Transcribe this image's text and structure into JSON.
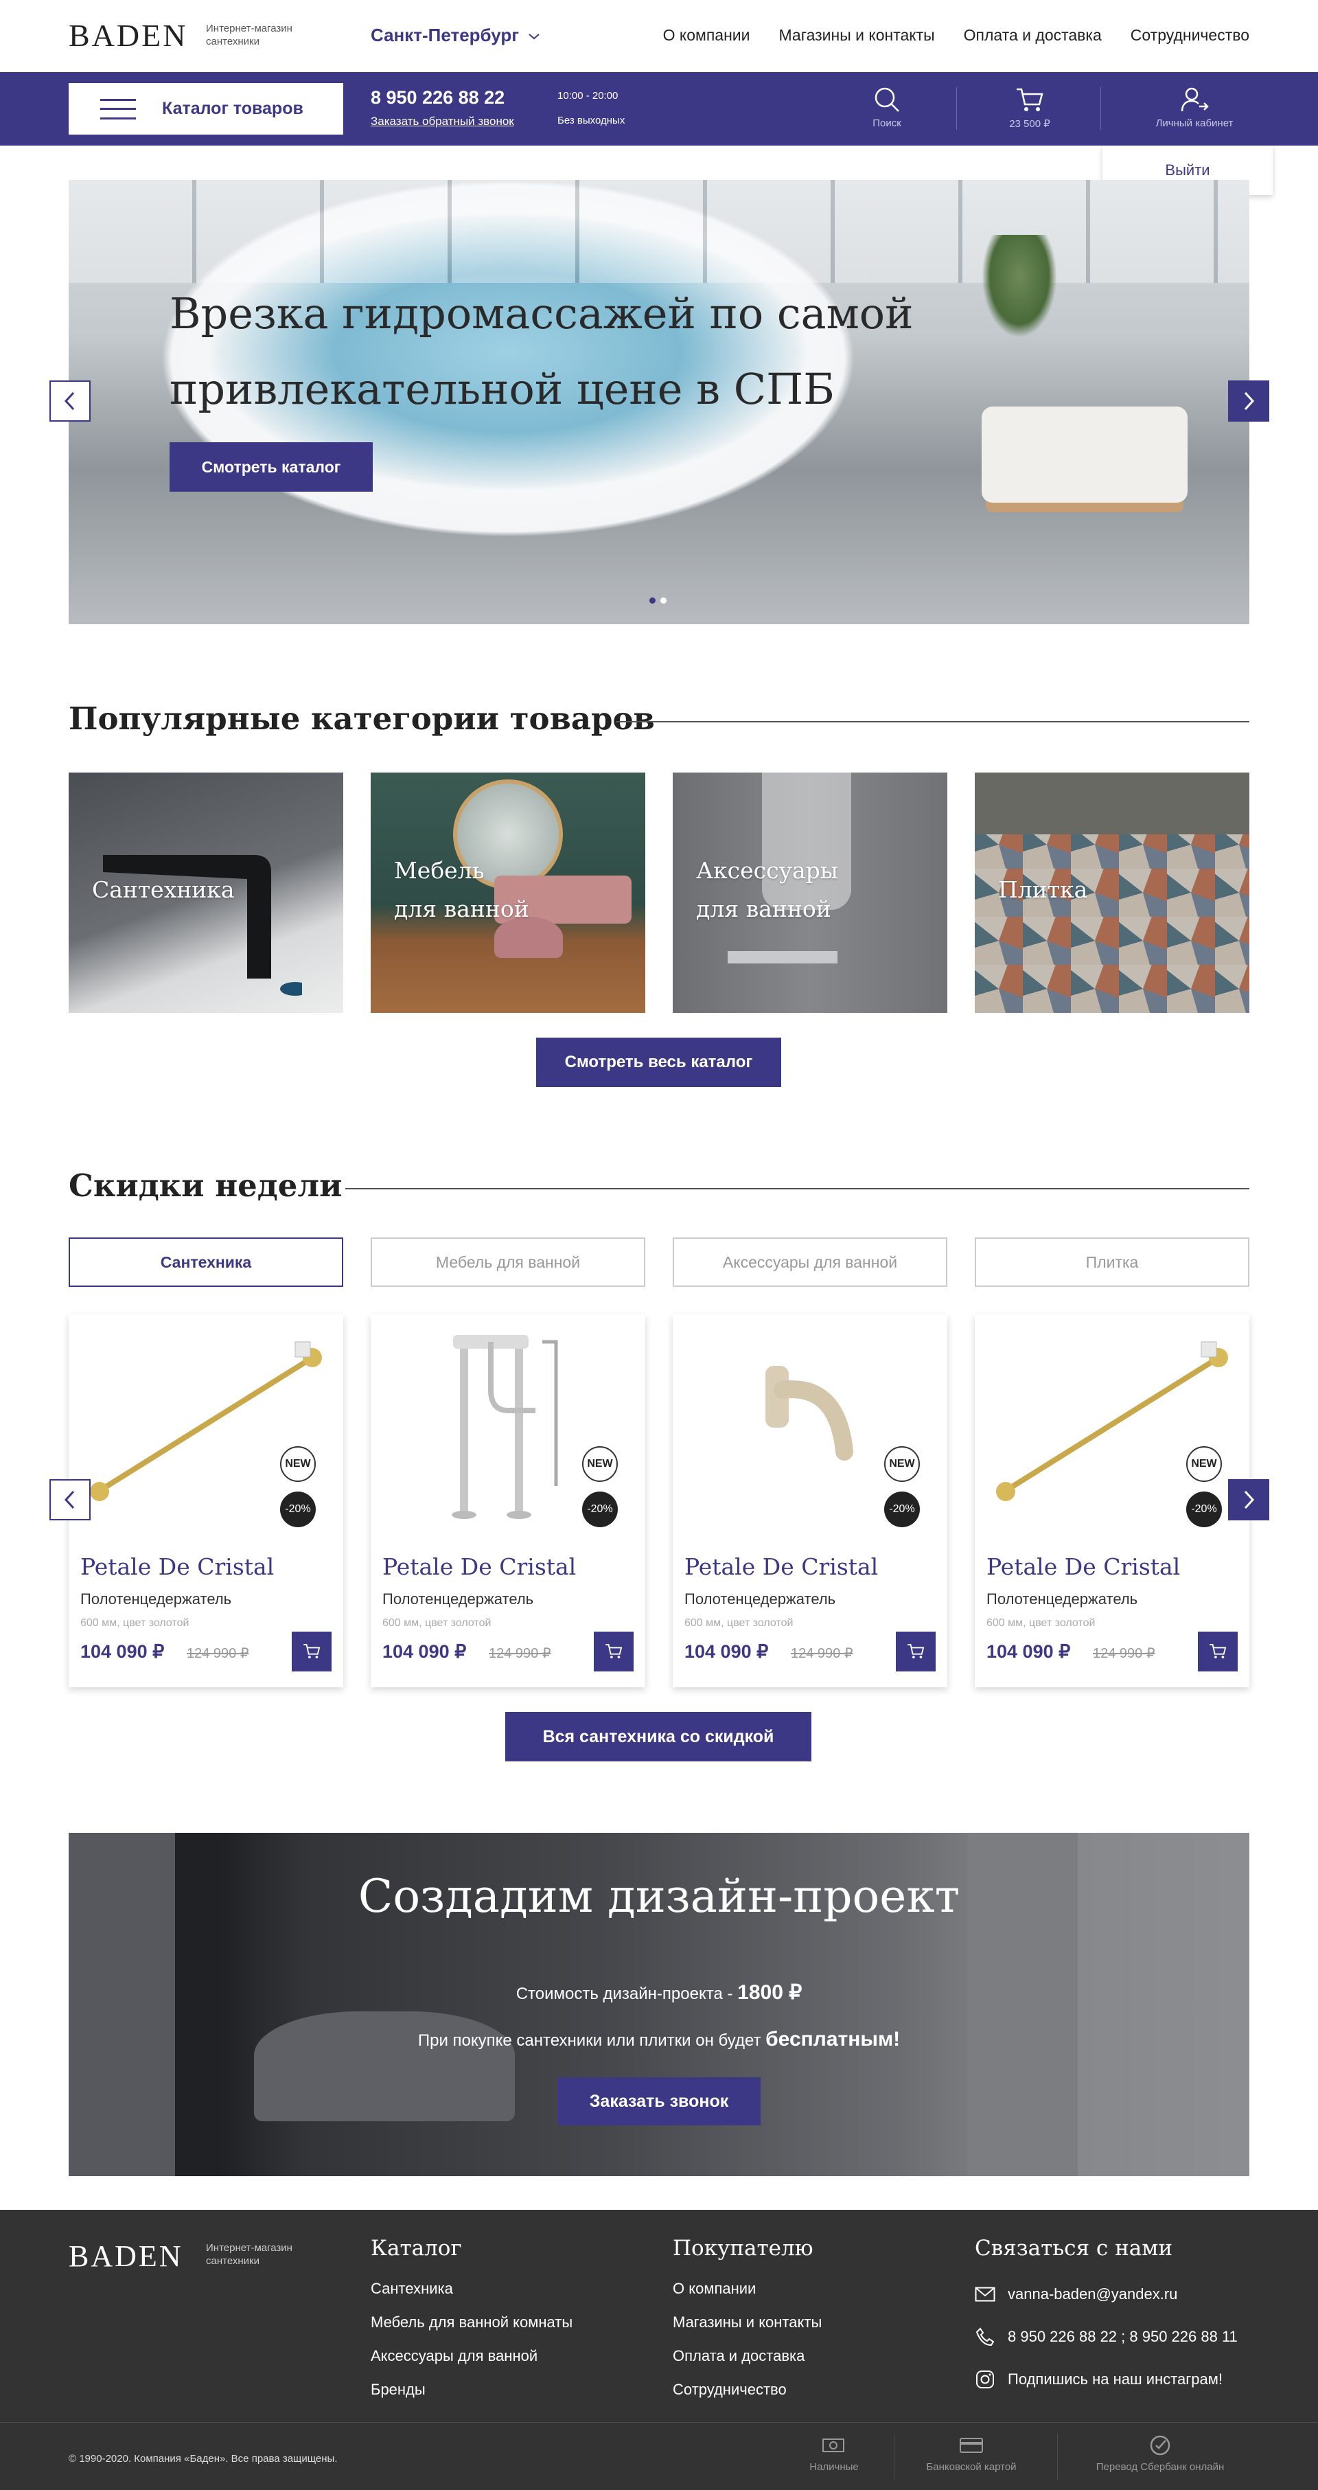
{
  "brand": {
    "logo": "BADEN",
    "tagline": "Интернет-магазин сантехники"
  },
  "header": {
    "city": "Санкт-Петербург",
    "nav": [
      "О компании",
      "Магазины и контакты",
      "Оплата и доставка",
      "Сотрудничество"
    ]
  },
  "bar": {
    "catalog_label": "Каталог товаров",
    "phone": "8 950 226 88 22",
    "callback": "Заказать обратный звонок",
    "hours": "10:00 - 20:00",
    "days": "Без выходных",
    "search": "Поиск",
    "cart_total": "23 500 ₽",
    "account": "Личный кабинет",
    "logout": "Выйти"
  },
  "hero": {
    "title": "Врезка гидромассажей по самой привлекательной цене в СПБ",
    "button": "Смотреть каталог",
    "slides": 2,
    "active_slide": 1
  },
  "categories": {
    "title": "Популярные категории товаров",
    "items": [
      {
        "line1": "Сантехника",
        "line2": ""
      },
      {
        "line1": "Мебель",
        "line2": "для ванной"
      },
      {
        "line1": "Аксессуары",
        "line2": "для ванной"
      },
      {
        "line1": "Плитка",
        "line2": ""
      }
    ],
    "button": "Смотреть весь каталог"
  },
  "discounts": {
    "title": "Скидки недели",
    "tabs": [
      "Сантехника",
      "Мебель для ванной",
      "Аксессуары для ванной",
      "Плитка"
    ],
    "active_tab": 0,
    "products": [
      {
        "name": "Petale De Cristal",
        "type": "Полотенцедержатель",
        "spec": "600 мм, цвет золотой",
        "price": "104 090 ₽",
        "old_price": "124 990 ₽",
        "badge_new": "NEW",
        "badge_sale": "-20%",
        "image": "towel-rail"
      },
      {
        "name": "Petale De Cristal",
        "type": "Полотенцедержатель",
        "spec": "600 мм, цвет золотой",
        "price": "104 090 ₽",
        "old_price": "124 990 ₽",
        "badge_new": "NEW",
        "badge_sale": "-20%",
        "image": "floor-faucet"
      },
      {
        "name": "Petale De Cristal",
        "type": "Полотенцедержатель",
        "spec": "600 мм, цвет золотой",
        "price": "104 090 ₽",
        "old_price": "124 990 ₽",
        "badge_new": "NEW",
        "badge_sale": "-20%",
        "image": "spout"
      },
      {
        "name": "Petale De Cristal",
        "type": "Полотенцедержатель",
        "spec": "600 мм, цвет золотой",
        "price": "104 090 ₽",
        "old_price": "124 990 ₽",
        "badge_new": "NEW",
        "badge_sale": "-20%",
        "image": "towel-rail"
      }
    ],
    "button": "Вся сантехника со скидкой"
  },
  "promo": {
    "title": "Создадим дизайн-проект",
    "line1_text": "Стоимость дизайн-проекта - ",
    "line1_bold": "1800 ₽",
    "line2_text": "При покупке сантехники или плитки он будет ",
    "line2_bold": "бесплатным!",
    "button": "Заказать звонок"
  },
  "footer": {
    "catalog_title": "Каталог",
    "catalog_links": [
      "Сантехника",
      "Мебель для ванной комнаты",
      "Аксессуары для ванной",
      "Бренды"
    ],
    "buyer_title": "Покупателю",
    "buyer_links": [
      "О компании",
      "Магазины и контакты",
      "Оплата и доставка",
      "Сотрудничество"
    ],
    "contact_title": "Связаться с нами",
    "email": "vanna-baden@yandex.ru",
    "phones": "8 950 226 88 22 ; 8 950 226 88 11",
    "instagram": "Подпишись на наш инстаграм!",
    "copyright": "© 1990-2020. Компания «Баден». Все права защищены.",
    "payments": [
      "Наличные",
      "Банковской картой",
      "Перевод Сбербанк онлайн"
    ]
  },
  "colors": {
    "accent": "#3d3885",
    "footer_bg": "#333333",
    "text": "#222222"
  }
}
